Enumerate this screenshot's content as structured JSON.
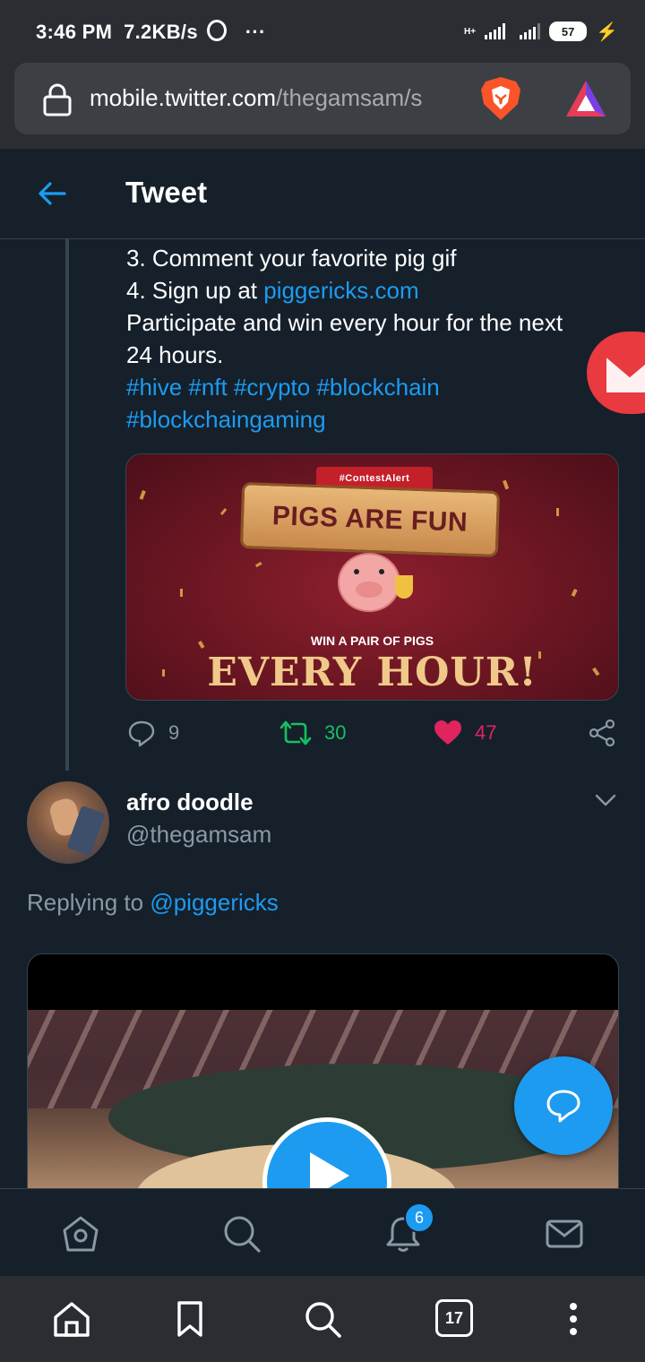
{
  "status_bar": {
    "time": "3:46 PM",
    "speed": "7.2KB/s",
    "more": "···",
    "network": "H+",
    "battery": "57"
  },
  "browser": {
    "url_domain": "mobile.twitter.com",
    "url_path": "/thegamsam/s",
    "tab_count": "17"
  },
  "header": {
    "title": "Tweet"
  },
  "tweet": {
    "line_comment": "3. Comment your favorite pig gif",
    "line_signup_prefix": "4. Sign up at ",
    "line_signup_link": "piggericks.com",
    "line_participate": "Participate and win every hour for the next",
    "line_hours": "24 hours.",
    "hashtags_line1": "#hive #nft #crypto #blockchain",
    "hashtags_line2": "#blockchaingaming",
    "image": {
      "badge": "#ContestAlert",
      "banner": "PIGS ARE FUN",
      "subtitle": "WIN A PAIR OF PIGS",
      "headline": "EVERY HOUR!"
    },
    "actions": {
      "replies": "9",
      "retweets": "30",
      "likes": "47"
    },
    "colors": {
      "link": "#1d9bf0",
      "retweet": "#17bf63",
      "like": "#e0245e"
    }
  },
  "reply": {
    "author_name": "afro doodle",
    "author_handle": "@thegamsam",
    "replying_prefix": "Replying to ",
    "replying_to": "@piggericks"
  },
  "notifications": {
    "count": "6"
  }
}
